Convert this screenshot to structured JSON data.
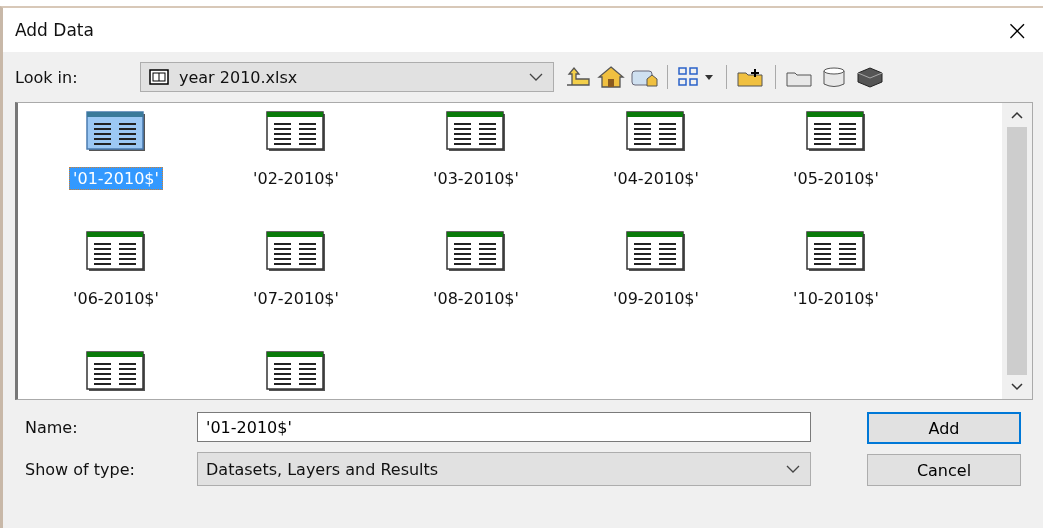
{
  "window": {
    "title": "Add Data",
    "close": "×"
  },
  "look_in": {
    "label": "Look in:",
    "value": "year 2010.xlsx"
  },
  "items": [
    {
      "label": "'01-2010$'",
      "selected": true
    },
    {
      "label": "'02-2010$'",
      "selected": false
    },
    {
      "label": "'03-2010$'",
      "selected": false
    },
    {
      "label": "'04-2010$'",
      "selected": false
    },
    {
      "label": "'05-2010$'",
      "selected": false
    },
    {
      "label": "'06-2010$'",
      "selected": false
    },
    {
      "label": "'07-2010$'",
      "selected": false
    },
    {
      "label": "'08-2010$'",
      "selected": false
    },
    {
      "label": "'09-2010$'",
      "selected": false
    },
    {
      "label": "'10-2010$'",
      "selected": false
    },
    {
      "selected": false
    },
    {
      "selected": false
    }
  ],
  "name": {
    "label": "Name:",
    "value": "'01-2010$'"
  },
  "type": {
    "label": "Show of type:",
    "value": "Datasets, Layers and Results"
  },
  "buttons": [
    {
      "label": "Add",
      "kind": "default"
    },
    {
      "label": "Cancel",
      "kind": "normal"
    }
  ]
}
